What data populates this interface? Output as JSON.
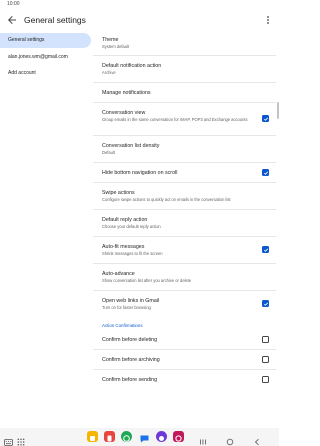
{
  "status_bar": {
    "time": "10:00"
  },
  "header": {
    "title": "General settings"
  },
  "sidebar": {
    "items": [
      {
        "label": "General settings",
        "active": true
      },
      {
        "label": "alan.jones.wm@gmail.com",
        "active": false
      },
      {
        "label": "Add account",
        "active": false
      }
    ]
  },
  "settings": {
    "theme": {
      "title": "Theme",
      "sub": "System default"
    },
    "default_notification_action": {
      "title": "Default notification action",
      "sub": "Archive"
    },
    "manage_notifications": {
      "title": "Manage notifications"
    },
    "conversation_view": {
      "title": "Conversation view",
      "sub": "Group emails in the same conversation for IMAP, POP3 and Exchange accounts",
      "checked": true
    },
    "conversation_list_density": {
      "title": "Conversation list density",
      "sub": "Default"
    },
    "hide_bottom_navigation": {
      "title": "Hide bottom navigation on scroll",
      "checked": true
    },
    "swipe_actions": {
      "title": "Swipe actions",
      "sub": "Configure swipe actions to quickly act on emails in the conversation list"
    },
    "default_reply_action": {
      "title": "Default reply action",
      "sub": "Choose your default reply action"
    },
    "auto_fit_messages": {
      "title": "Auto-fit messages",
      "sub": "Shrink messages to fit the screen",
      "checked": true
    },
    "auto_advance": {
      "title": "Auto-advance",
      "sub": "Show conversation list after you archive or delete"
    },
    "open_web_links": {
      "title": "Open web links in Gmail",
      "sub": "Turn on for faster browsing",
      "checked": true
    },
    "action_confirmations_header": "Action Confirmations",
    "confirm_before_deleting": {
      "title": "Confirm before deleting",
      "checked": false
    },
    "confirm_before_archiving": {
      "title": "Confirm before archiving",
      "checked": false
    },
    "confirm_before_sending": {
      "title": "Confirm before sending",
      "checked": false
    }
  },
  "colors": {
    "accent": "#0b57d0",
    "sidebar_active": "#d3e3fd"
  },
  "nav_bar": {
    "apps": [
      "keyboard-icon",
      "app-drawer-icon",
      "sticky-app-icon",
      "phone-app-icon",
      "whatsapp-icon",
      "chat-app-icon",
      "browser-icon",
      "camera-app-icon",
      "recents-icon",
      "home-icon",
      "back-icon"
    ]
  }
}
